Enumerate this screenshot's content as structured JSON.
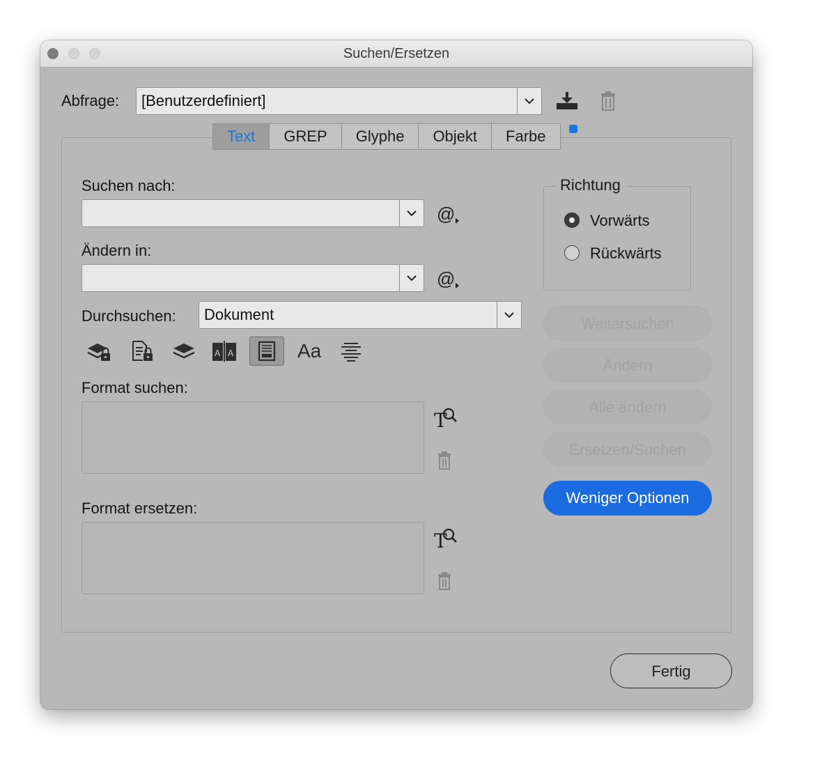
{
  "window": {
    "title": "Suchen/Ersetzen"
  },
  "query": {
    "label": "Abfrage:",
    "value": "[Benutzerdefiniert]",
    "icons": [
      "save-query-icon",
      "delete-query-icon"
    ]
  },
  "tabs": [
    {
      "label": "Text",
      "active": true
    },
    {
      "label": "GREP",
      "active": false
    },
    {
      "label": "Glyphe",
      "active": false
    },
    {
      "label": "Objekt",
      "active": false
    },
    {
      "label": "Farbe",
      "active": false
    }
  ],
  "search": {
    "find_label": "Suchen nach:",
    "find_value": "",
    "change_label": "Ändern in:",
    "change_value": "",
    "special_char_icon_text": "@",
    "scope_label": "Durchsuchen:",
    "scope_value": "Dokument"
  },
  "options_toolbar": [
    {
      "name": "include-locked-layers-icon",
      "selected": false
    },
    {
      "name": "include-locked-stories-icon",
      "selected": false
    },
    {
      "name": "include-hidden-layers-icon",
      "selected": false
    },
    {
      "name": "include-master-pages-icon",
      "selected": false
    },
    {
      "name": "include-footnotes-icon",
      "selected": true
    },
    {
      "name": "case-sensitive-icon",
      "selected": false,
      "text": "Aa"
    },
    {
      "name": "whole-word-icon",
      "selected": false
    }
  ],
  "format": {
    "find_label": "Format suchen:",
    "change_label": "Format ersetzen:"
  },
  "direction": {
    "title": "Richtung",
    "forward": "Vorwärts",
    "backward": "Rückwärts",
    "selected": "forward"
  },
  "actions": {
    "find_next": "Weitersuchen",
    "change": "Ändern",
    "change_all": "Alle ändern",
    "change_find": "Ersetzen/Suchen",
    "fewer_options": "Weniger Optionen",
    "done": "Fertig"
  },
  "colors": {
    "accent": "#1a6ce0",
    "active_tab_text": "#1f73d8",
    "panel_bg": "#b8b8b8"
  }
}
